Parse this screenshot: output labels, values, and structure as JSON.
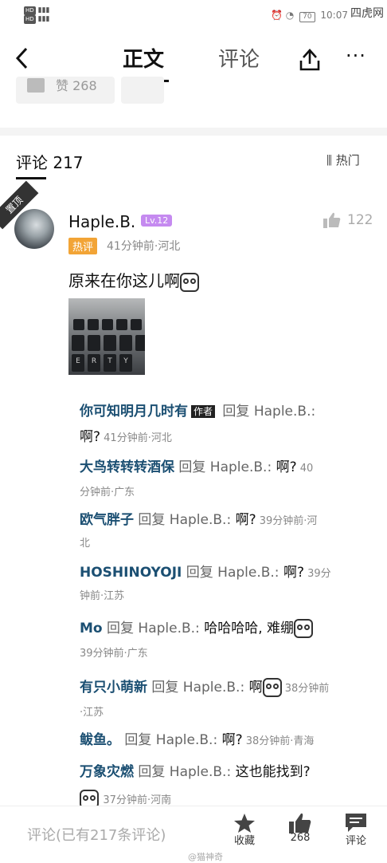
{
  "status": {
    "left_line1": "HD",
    "left_line2": "HD",
    "battery": "70",
    "time": "10:07"
  },
  "watermark": "四虎网",
  "nav": {
    "tab_main": "正文",
    "tab_comment": "评论",
    "back_icon": "chevron-left",
    "more": "···"
  },
  "article": {
    "like_label": "赞 268"
  },
  "comments": {
    "header": "评论 217",
    "sort": "热门",
    "pinned_label": "置顶",
    "top": {
      "author": "Haple.B.",
      "level": "Lv.12",
      "likes": "122",
      "badge": "热评",
      "meta": "41分钟前·河北",
      "text": "原来在你这儿啊"
    },
    "replies": [
      {
        "name": "你可知明月几时有",
        "tag": "作者",
        "mid": " 回复 Haple.B.: ",
        "text": "",
        "time": ""
      },
      {
        "name": "",
        "tag": "",
        "mid": "",
        "text": "啊?",
        "time": " 41分钟前·河北"
      },
      {
        "name": "大鸟转转转酒保",
        "tag": "",
        "mid": " 回复 Haple.B.: ",
        "text": "啊?",
        "time": " 40"
      },
      {
        "name": "",
        "tag": "",
        "mid": "",
        "text": "",
        "time": "分钟前·广东"
      },
      {
        "name": "欧气胖子",
        "tag": "",
        "mid": " 回复 Haple.B.: ",
        "text": "啊?",
        "time": " 39分钟前·河"
      },
      {
        "name": "",
        "tag": "",
        "mid": "",
        "text": "",
        "time": "北"
      },
      {
        "name": "HOSHINOYOJI",
        "tag": "",
        "mid": " 回复 Haple.B.: ",
        "text": "啊?",
        "time": " 39分"
      },
      {
        "name": "",
        "tag": "",
        "mid": "",
        "text": "",
        "time": "钟前·江苏"
      },
      {
        "name": "Mo",
        "tag": "",
        "mid": " 回复 Haple.B.: ",
        "text": "哈哈哈哈, 难绷",
        "time": ""
      },
      {
        "name": "",
        "tag": "",
        "mid": "",
        "text": "",
        "time": "39分钟前·广东"
      },
      {
        "name": "有只小萌新",
        "tag": "",
        "mid": " 回复 Haple.B.: ",
        "text": "啊",
        "time": " 38分钟前"
      },
      {
        "name": "",
        "tag": "",
        "mid": "",
        "text": "",
        "time": "·江苏"
      },
      {
        "name": "鲅鱼。",
        "tag": "",
        "mid": " 回复 Haple.B.: ",
        "text": "啊?",
        "time": " 38分钟前·青海"
      },
      {
        "name": "万象灾燃",
        "tag": "",
        "mid": " 回复 Haple.B.: ",
        "text": "这也能找到?",
        "time": ""
      },
      {
        "name": "",
        "tag": "",
        "mid": "",
        "text": "",
        "time": "37分钟前·河南"
      }
    ]
  },
  "bottom": {
    "placeholder": "评论(已有217条评论)",
    "collect": "收藏",
    "likes": "268",
    "comment": "评论",
    "watermark": "@猫神奇"
  },
  "photo_keys": [
    "E",
    "R",
    "T",
    "Y"
  ]
}
